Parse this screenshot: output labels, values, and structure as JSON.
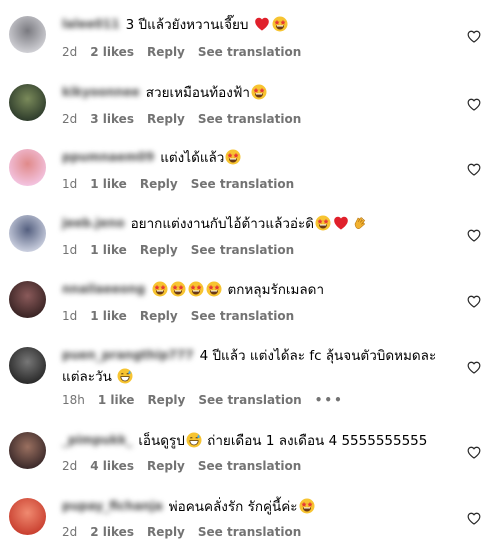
{
  "comments": [
    {
      "username": "lalee011",
      "avatar_colors": [
        "#cfcfd4",
        "#7a7a80"
      ],
      "text_parts": [
        {
          "t": "3 ปีแล้วยังหวานเจี๊ยบ "
        },
        {
          "emoji": "red-heart"
        },
        {
          "emoji": "star-struck"
        }
      ],
      "age": "2d",
      "likes": "2 likes",
      "reply": "Reply",
      "translation": "See translation"
    },
    {
      "username": "kikyoonnee",
      "avatar_colors": [
        "#2f3d2c",
        "#7a8a5a"
      ],
      "text_parts": [
        {
          "t": "สวยเหมือนท้องฟ้า"
        },
        {
          "emoji": "star-struck"
        }
      ],
      "age": "2d",
      "likes": "3 likes",
      "reply": "Reply",
      "translation": "See translation"
    },
    {
      "username": "ppumnaem09",
      "avatar_colors": [
        "#f3c3df",
        "#e08a8a"
      ],
      "text_parts": [
        {
          "t": "แต่งได้แล้ว"
        },
        {
          "emoji": "star-struck"
        }
      ],
      "age": "1d",
      "likes": "1 like",
      "reply": "Reply",
      "translation": "See translation"
    },
    {
      "username": "jeeb.jeno",
      "avatar_colors": [
        "#c9cede",
        "#556080"
      ],
      "text_parts": [
        {
          "t": "อยากแต่งงานกับไอ้ต้าวแล้วอ่ะดิ"
        },
        {
          "emoji": "star-struck"
        },
        {
          "emoji": "red-heart"
        },
        {
          "emoji": "clap"
        }
      ],
      "age": "1d",
      "likes": "1 like",
      "reply": "Reply",
      "translation": "See translation"
    },
    {
      "username": "nnailaeeong",
      "avatar_colors": [
        "#3a2424",
        "#8a5a5a"
      ],
      "text_parts": [
        {
          "emoji": "star-struck"
        },
        {
          "emoji": "star-struck"
        },
        {
          "emoji": "star-struck"
        },
        {
          "emoji": "star-struck"
        },
        {
          "t": " ตกหลุมรักเมลดา"
        }
      ],
      "age": "1d",
      "likes": "1 like",
      "reply": "Reply",
      "translation": "See translation"
    },
    {
      "username": "puen_prangthip777",
      "avatar_colors": [
        "#2a2a2a",
        "#777777"
      ],
      "text_parts": [
        {
          "t": "4 ปีแล้ว แต่งได้ละ fc ลุ้นจนตัวบิดหมดละแต่ละวัน "
        },
        {
          "emoji": "grin-sweat"
        }
      ],
      "age": "18h",
      "likes": "1 like",
      "reply": "Reply",
      "translation": "See translation",
      "more": "•••"
    },
    {
      "username": "_pimpukk_",
      "avatar_colors": [
        "#3c2a2a",
        "#9a7060"
      ],
      "text_parts": [
        {
          "t": "เอ็นดูรูป"
        },
        {
          "emoji": "grin-sweat"
        },
        {
          "t": " ถ่ายเดือน 1 ลงเดือน 4 5555555555"
        }
      ],
      "age": "2d",
      "likes": "4 likes",
      "reply": "Reply",
      "translation": "See translation"
    },
    {
      "username": "pupay_fichanja",
      "avatar_colors": [
        "#c94030",
        "#f08a70"
      ],
      "text_parts": [
        {
          "t": "พ่อคนคลั่งรัก รักคู่นี้ค่ะ"
        },
        {
          "emoji": "star-struck"
        }
      ],
      "age": "2d",
      "likes": "2 likes",
      "reply": "Reply",
      "translation": "See translation"
    }
  ],
  "colors": {
    "meta": "#737373",
    "heart": "#262626"
  }
}
